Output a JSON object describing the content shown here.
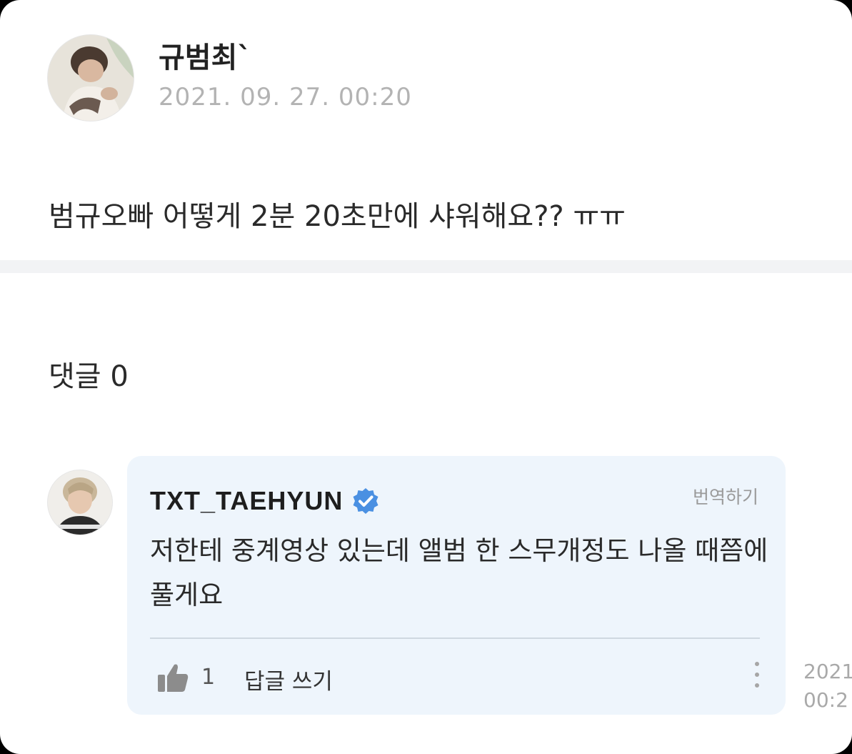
{
  "post": {
    "author": "규범최`",
    "timestamp": "2021. 09. 27. 00:20",
    "body": "범규오빠 어떻게 2분 20초만에 샤워해요?? ㅠㅠ",
    "avatar_icon": "profile-photo"
  },
  "comments": {
    "count_label": "댓글 0"
  },
  "comment": {
    "author": "TXT_TAEHYUN",
    "verified_icon": "verified-badge",
    "verified_color": "#4a90e2",
    "translate_label": "번역하기",
    "text": "저한테 중계영상 있는데 앨범 한 스무개정도 나올 때쯤에 풀게요",
    "like_icon": "thumbs-up",
    "like_count": "1",
    "reply_label": "답글 쓰기",
    "more_icon": "vertical-ellipsis",
    "timestamp_line1": "2021",
    "timestamp_line2": "00:2",
    "card_color": "#eef5fc"
  }
}
